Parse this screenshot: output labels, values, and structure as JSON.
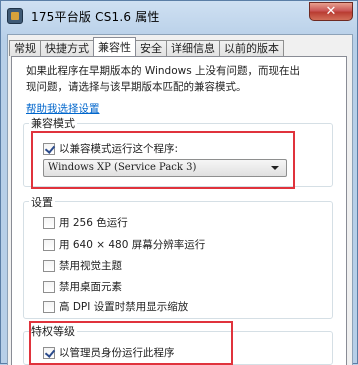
{
  "window": {
    "title": "175平台版 CS1.6 属性",
    "close_label": "✕"
  },
  "tabs": [
    {
      "label": "常规",
      "active": false
    },
    {
      "label": "快捷方式",
      "active": false
    },
    {
      "label": "兼容性",
      "active": true
    },
    {
      "label": "安全",
      "active": false
    },
    {
      "label": "详细信息",
      "active": false
    },
    {
      "label": "以前的版本",
      "active": false
    }
  ],
  "info": {
    "line1": "如果此程序在早期版本的 Windows 上没有问题，而现在出",
    "line2": "现问题，请选择与该早期版本匹配的兼容模式。",
    "help_link": "帮助我选择设置"
  },
  "compat_mode": {
    "group_label": "兼容模式",
    "checkbox_label": "以兼容模式运行这个程序:",
    "checked": true,
    "selected_os": "Windows XP (Service Pack 3)"
  },
  "settings": {
    "group_label": "设置",
    "options": [
      {
        "label": "用 256 色运行",
        "checked": false
      },
      {
        "label": "用 640 × 480 屏幕分辨率运行",
        "checked": false
      },
      {
        "label": "禁用视觉主题",
        "checked": false
      },
      {
        "label": "禁用桌面元素",
        "checked": false
      },
      {
        "label": "高 DPI 设置时禁用显示缩放",
        "checked": false
      }
    ]
  },
  "privilege": {
    "group_label": "特权等级",
    "checkbox_label": "以管理员身份运行此程序",
    "checked": true
  },
  "colors": {
    "highlight_box": "#e0333c",
    "link": "#0066cc"
  }
}
